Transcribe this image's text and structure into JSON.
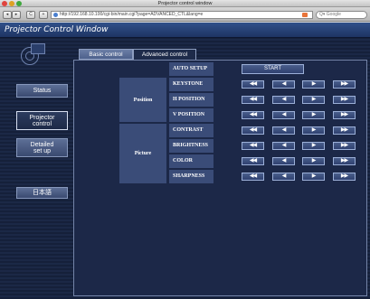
{
  "browser": {
    "window_title": "Projector control window",
    "back_glyph": "◂",
    "forward_glyph": "▸",
    "reload_glyph": "C",
    "add_glyph": "+",
    "url": "http://192.168.10.100/cgi-bin/main.cgi?page=ADVANCED_CTL&lang=e",
    "search_placeholder": "Q▾ Google"
  },
  "header": {
    "title": "Projector Control Window"
  },
  "sidebar": {
    "items": [
      {
        "lines": [
          "Status"
        ],
        "active": false
      },
      {
        "lines": [
          "Projector",
          "control"
        ],
        "active": true
      },
      {
        "lines": [
          "Detailed",
          "set up"
        ],
        "active": false
      },
      {
        "lines": [
          "日本語"
        ],
        "active": false
      }
    ]
  },
  "tabs": {
    "basic": "Basic control",
    "advanced": "Advanced control"
  },
  "controls": {
    "auto_setup_label": "AUTO SETUP",
    "start_label": "START",
    "groups": [
      {
        "name": "Position",
        "rows": [
          "KEYSTONE",
          "H POSITION",
          "V POSITION"
        ]
      },
      {
        "name": "Picture",
        "rows": [
          "CONTRAST",
          "BRIGHTNESS",
          "COLOR",
          "SHARPNESS"
        ]
      }
    ],
    "button_glyphs": [
      "◀◀",
      "◀",
      "▶",
      "▶▶"
    ]
  },
  "colors": {
    "page_bg": "#15203a",
    "header_bg": "#1e3463",
    "cell_bg": "#3a4c78",
    "button_border": "#9cb0d8"
  }
}
